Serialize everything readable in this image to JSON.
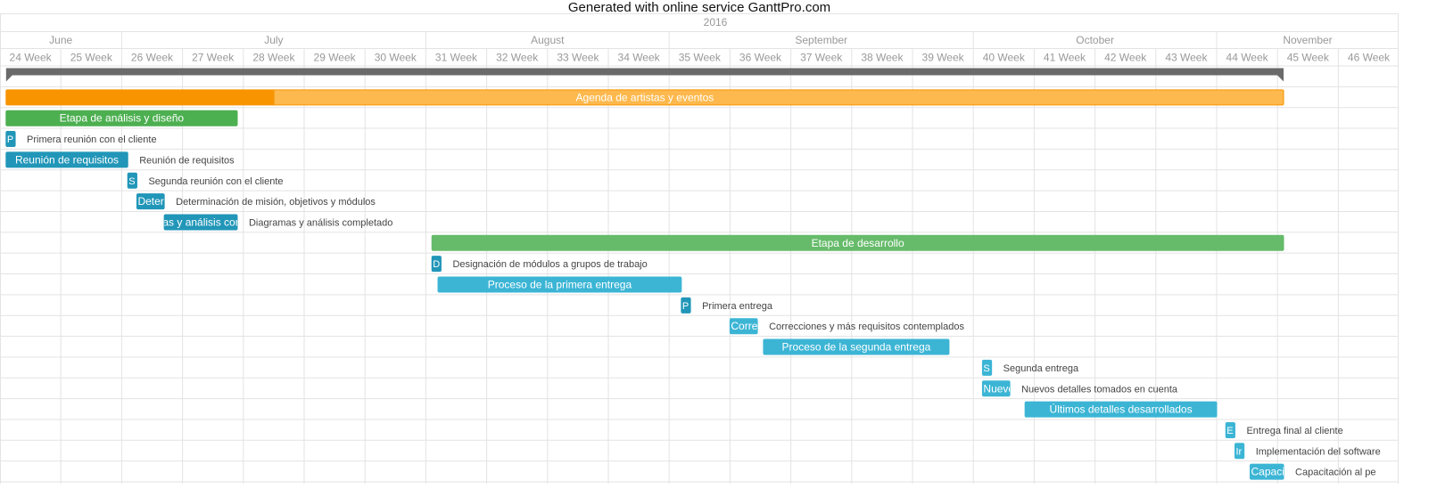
{
  "title": "Generated with online service GanttPro.com",
  "colors": {
    "summary": "#6a6a6a",
    "orange_dark": "#f79400",
    "orange_light": "#fdb94e",
    "green_dark": "#4caf50",
    "green_light": "#66bb6a",
    "blue_dark": "#2196b8",
    "blue_light": "#3cb5d5",
    "grid": "#e3e3e3",
    "header_text": "#999999",
    "label_text": "#444444"
  },
  "chart_data": {
    "type": "gantt",
    "year": "2016",
    "months": [
      {
        "label": "June",
        "from_week": 24,
        "to_week": 26
      },
      {
        "label": "July",
        "from_week": 26,
        "to_week": 31
      },
      {
        "label": "August",
        "from_week": 31,
        "to_week": 35
      },
      {
        "label": "September",
        "from_week": 35,
        "to_week": 40
      },
      {
        "label": "October",
        "from_week": 40,
        "to_week": 44
      },
      {
        "label": "November",
        "from_week": 44,
        "to_week": 47
      }
    ],
    "weeks": [
      "24 Week",
      "25 Week",
      "26 Week",
      "27 Week",
      "28 Week",
      "29 Week",
      "30 Week",
      "31 Week",
      "32 Week",
      "33 Week",
      "34 Week",
      "35 Week",
      "36 Week",
      "37 Week",
      "38 Week",
      "39 Week",
      "40 Week",
      "41 Week",
      "42 Week",
      "43 Week",
      "44 Week",
      "45 Week",
      "46 Week"
    ],
    "tasks": [
      {
        "kind": "summary",
        "start": 24.1,
        "end": 45.1,
        "bar_text": "",
        "side_text": ""
      },
      {
        "kind": "orange",
        "start": 24.1,
        "end": 45.1,
        "progress": 0.21,
        "bar_text": "Agenda de artistas y eventos",
        "side_text": ""
      },
      {
        "kind": "green",
        "start": 24.1,
        "end": 27.9,
        "progress": 1,
        "bar_text": "Etapa de análisis y diseño",
        "side_text": ""
      },
      {
        "kind": "blue",
        "start": 24.1,
        "end": 24.25,
        "progress": 1,
        "bar_text": "P",
        "side_text": "Primera reunión con el cliente"
      },
      {
        "kind": "blue",
        "start": 24.1,
        "end": 26.1,
        "progress": 1,
        "bar_text": "Reunión de requisitos",
        "side_text": "Reunión de requisitos"
      },
      {
        "kind": "blue",
        "start": 26.1,
        "end": 26.25,
        "progress": 1,
        "bar_text": "S",
        "side_text": "Segunda reunión con el cliente"
      },
      {
        "kind": "blue",
        "start": 26.25,
        "end": 26.7,
        "progress": 1,
        "bar_text": "Determinación de misión, objetivos y módulos",
        "side_text": "Determinación de misión, objetivos y módulos"
      },
      {
        "kind": "blue",
        "start": 26.7,
        "end": 27.9,
        "progress": 1,
        "bar_text": "Diagramas y análisis completado",
        "side_text": "Diagramas y análisis completado"
      },
      {
        "kind": "green_light",
        "start": 31.1,
        "end": 45.1,
        "progress": 0,
        "bar_text": "Etapa de desarrollo",
        "side_text": ""
      },
      {
        "kind": "blue",
        "start": 31.1,
        "end": 31.25,
        "progress": 1,
        "bar_text": "D",
        "side_text": "Designación de módulos a grupos de trabajo"
      },
      {
        "kind": "blue_light",
        "start": 31.2,
        "end": 35.2,
        "progress": 0,
        "bar_text": "Proceso de la primera entrega",
        "side_text": ""
      },
      {
        "kind": "blue",
        "start": 35.2,
        "end": 35.35,
        "progress": 1,
        "bar_text": "P",
        "side_text": "Primera entrega"
      },
      {
        "kind": "blue_light",
        "start": 36.0,
        "end": 36.45,
        "progress": 0,
        "bar_text": "Correcciones y más requisitos contemplados",
        "side_text": "Correcciones y más requisitos contemplados"
      },
      {
        "kind": "blue_light",
        "start": 36.55,
        "end": 39.6,
        "progress": 0,
        "bar_text": "Proceso de la segunda entrega",
        "side_text": ""
      },
      {
        "kind": "blue_light",
        "start": 40.15,
        "end": 40.3,
        "progress": 0,
        "bar_text": "S",
        "side_text": "Segunda entrega"
      },
      {
        "kind": "blue_light",
        "start": 40.15,
        "end": 40.6,
        "progress": 0,
        "bar_text": "Nuevos detalles tomados en cuenta",
        "side_text": "Nuevos detalles tomados en cuenta"
      },
      {
        "kind": "blue_light",
        "start": 40.85,
        "end": 44.0,
        "progress": 0,
        "bar_text": "Últimos detalles desarrollados",
        "side_text": ""
      },
      {
        "kind": "blue_light",
        "start": 44.15,
        "end": 44.3,
        "progress": 0,
        "bar_text": "E",
        "side_text": "Entrega final al cliente"
      },
      {
        "kind": "blue_light",
        "start": 44.3,
        "end": 44.45,
        "progress": 0,
        "bar_text": "Ir",
        "side_text": "Implementación del software"
      },
      {
        "kind": "blue_light",
        "start": 44.55,
        "end": 45.1,
        "progress": 0,
        "bar_text": "Capacitación",
        "side_text": "Capacitación al pe"
      }
    ]
  }
}
